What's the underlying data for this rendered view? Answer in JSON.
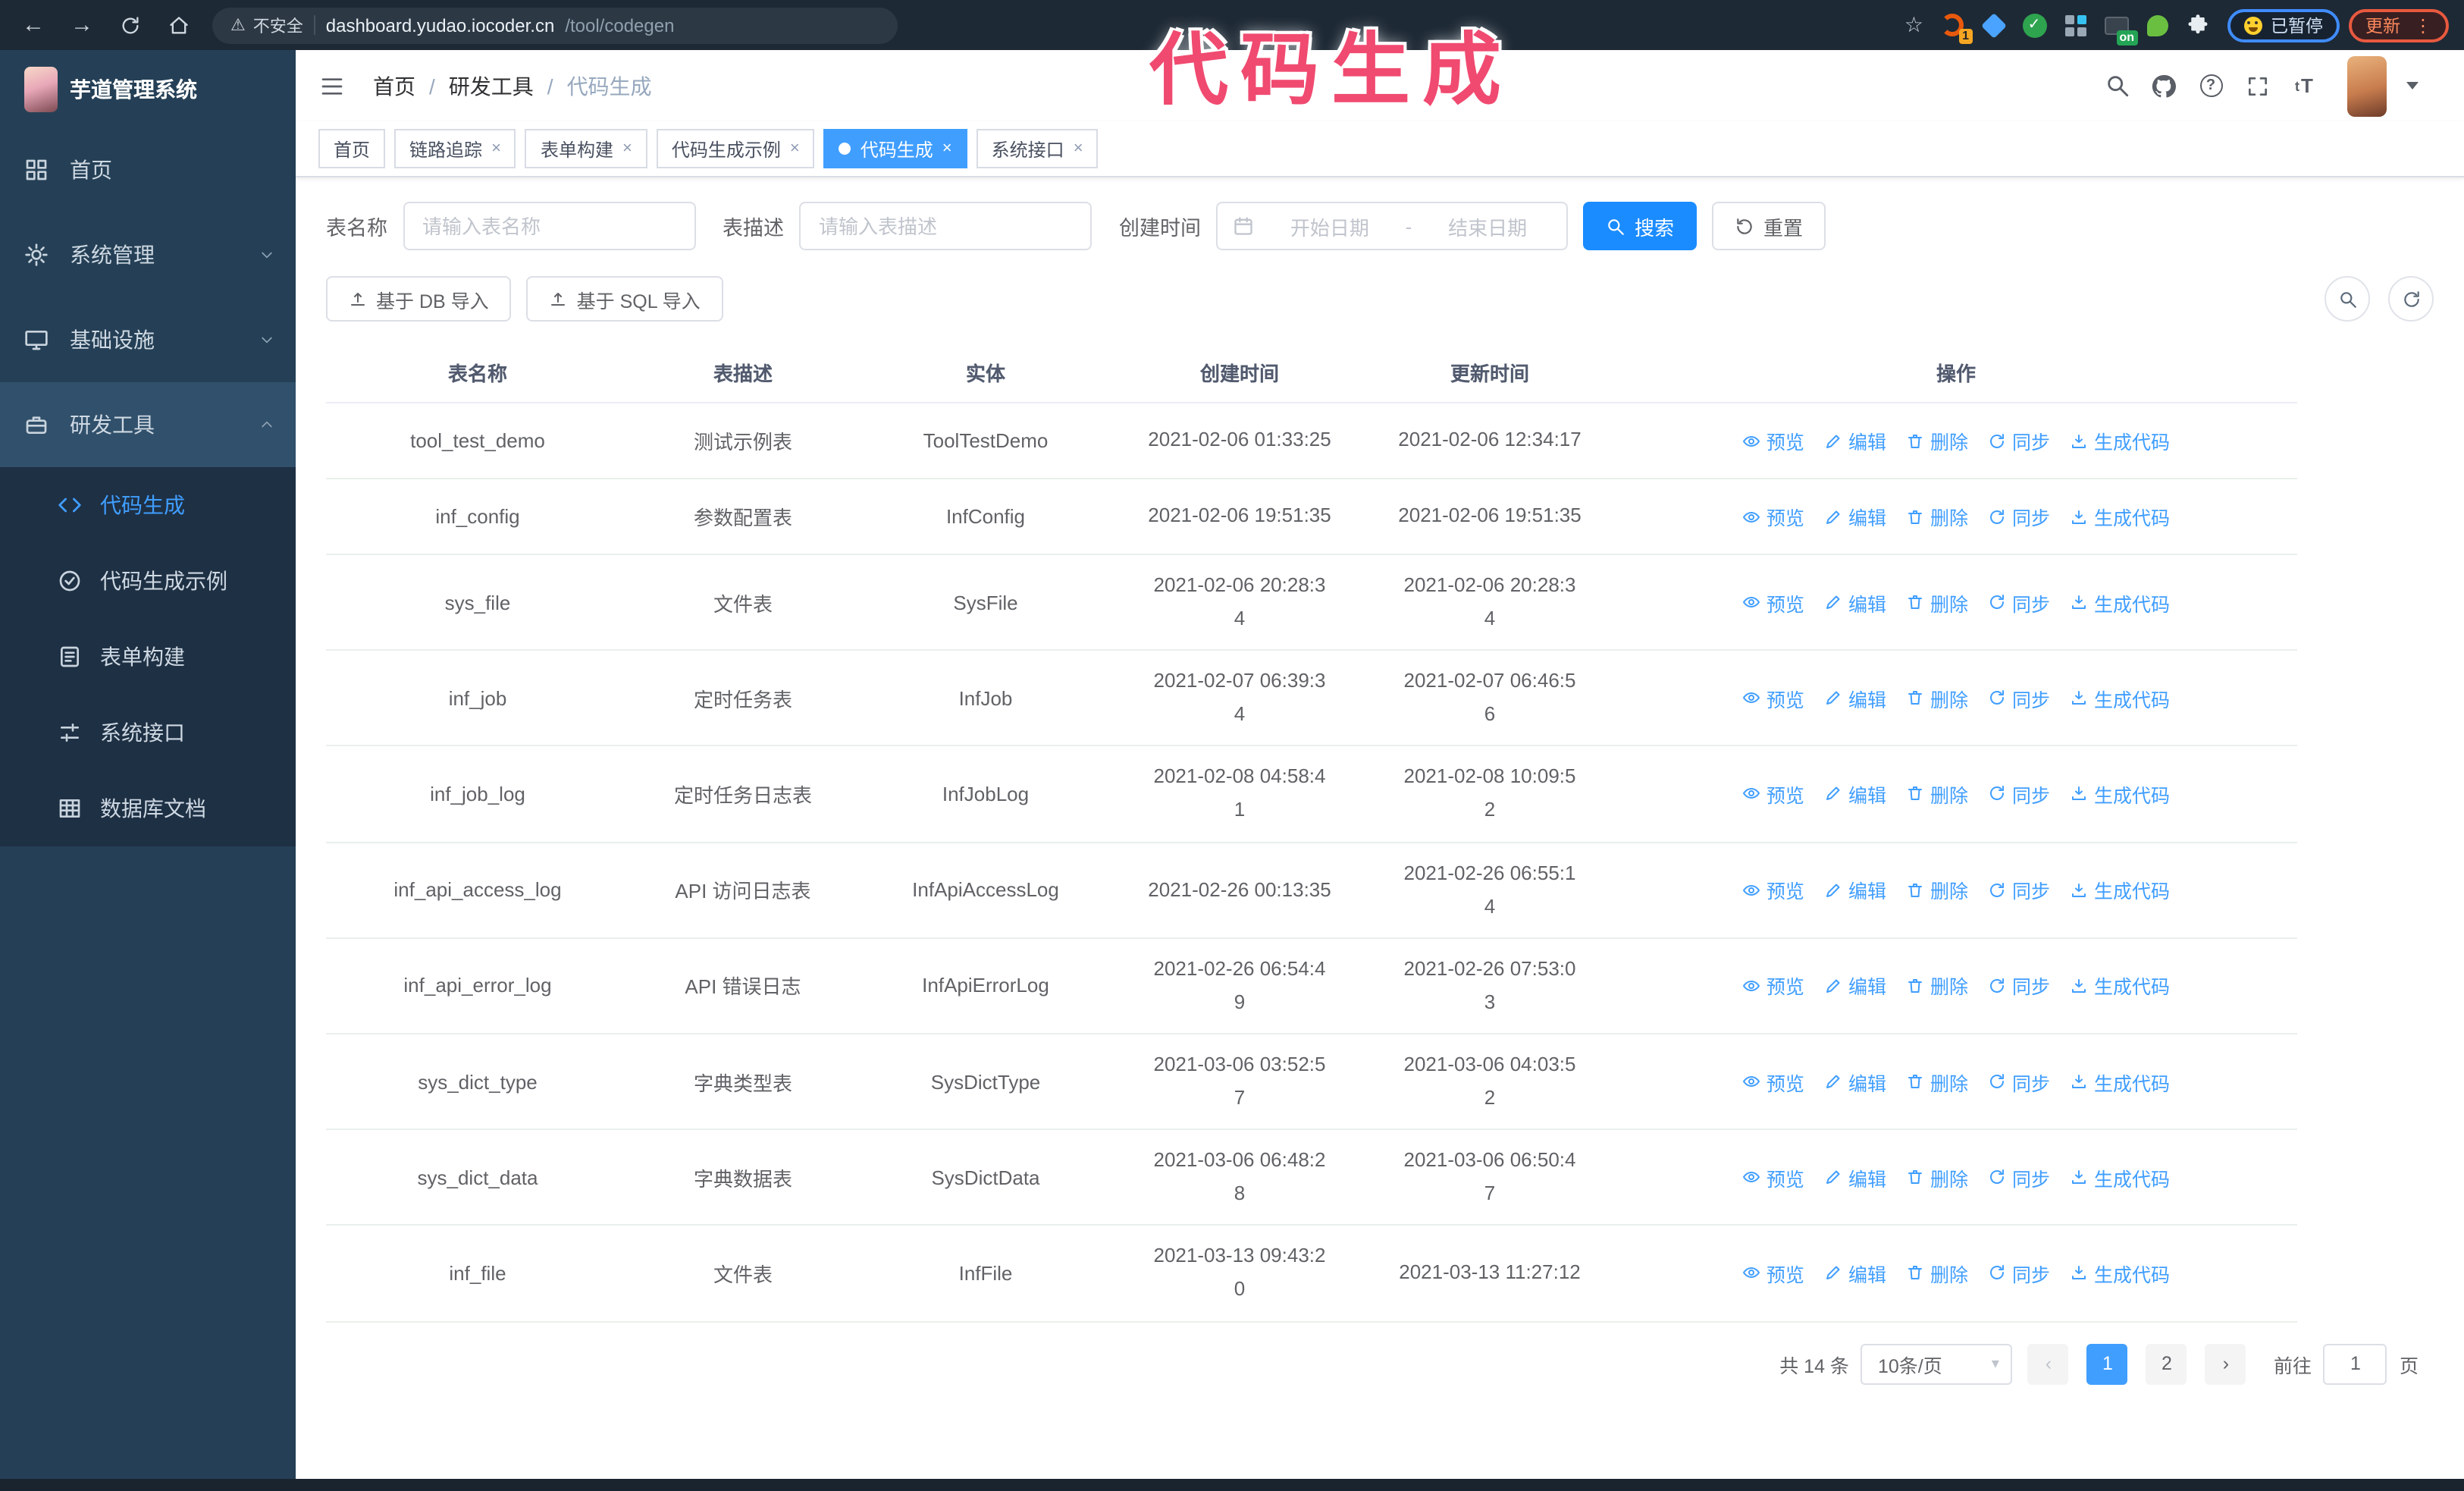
{
  "annotation": {
    "text": "代码生成",
    "color": "#f04a70"
  },
  "browser": {
    "warning_label": "不安全",
    "url_host": "dashboard.yudao.iocoder.cn",
    "url_path": "/tool/codegen",
    "extension_badge": "1",
    "extension_on_badge": "on",
    "paused_badge": "已暂停",
    "update_button": "更新"
  },
  "icons": {
    "star": "☆",
    "warning": "⚠",
    "caret_down": "▾",
    "kebab": "⋮",
    "check": "✓",
    "prev": "‹",
    "next": "›",
    "close": "×"
  },
  "sidebar": {
    "logo_title": "芋道管理系统",
    "items": [
      {
        "label": "首页",
        "icon": "dashboard-icon"
      },
      {
        "label": "系统管理",
        "icon": "gear-icon",
        "chevron": "down"
      },
      {
        "label": "基础设施",
        "icon": "infra-icon",
        "chevron": "down"
      },
      {
        "label": "研发工具",
        "icon": "tools-icon",
        "chevron": "up",
        "open": true
      }
    ],
    "submenu": [
      {
        "label": "代码生成",
        "icon": "code-icon",
        "active": true
      },
      {
        "label": "代码生成示例",
        "icon": "example-icon"
      },
      {
        "label": "表单构建",
        "icon": "form-icon"
      },
      {
        "label": "系统接口",
        "icon": "api-icon"
      },
      {
        "label": "数据库文档",
        "icon": "dbdoc-icon"
      }
    ]
  },
  "header": {
    "breadcrumb": [
      "首页",
      "研发工具",
      "代码生成"
    ],
    "separator": "/"
  },
  "tabs": [
    {
      "label": "首页",
      "closable": false,
      "active": false
    },
    {
      "label": "链路追踪",
      "closable": true,
      "active": false
    },
    {
      "label": "表单构建",
      "closable": true,
      "active": false
    },
    {
      "label": "代码生成示例",
      "closable": true,
      "active": false
    },
    {
      "label": "代码生成",
      "closable": true,
      "active": true
    },
    {
      "label": "系统接口",
      "closable": true,
      "active": false
    }
  ],
  "filters": {
    "name_label": "表名称",
    "name_placeholder": "请输入表名称",
    "desc_label": "表描述",
    "desc_placeholder": "请输入表描述",
    "time_label": "创建时间",
    "start_placeholder": "开始日期",
    "range_separator": "-",
    "end_placeholder": "结束日期",
    "search_label": "搜索",
    "reset_label": "重置"
  },
  "toolbar": {
    "db_import_label": "基于 DB 导入",
    "sql_import_label": "基于 SQL 导入"
  },
  "table": {
    "columns": [
      "表名称",
      "表描述",
      "实体",
      "创建时间",
      "更新时间",
      "操作"
    ],
    "actions": [
      "预览",
      "编辑",
      "删除",
      "同步",
      "生成代码"
    ],
    "rows": [
      {
        "name": "tool_test_demo",
        "desc": "测试示例表",
        "entity": "ToolTestDemo",
        "created": "2021-02-06 01:33:25",
        "updated": "2021-02-06 12:34:17"
      },
      {
        "name": "inf_config",
        "desc": "参数配置表",
        "entity": "InfConfig",
        "created": "2021-02-06 19:51:35",
        "updated": "2021-02-06 19:51:35"
      },
      {
        "name": "sys_file",
        "desc": "文件表",
        "entity": "SysFile",
        "created": "2021-02-06 20:28:3\n4",
        "updated": "2021-02-06 20:28:3\n4"
      },
      {
        "name": "inf_job",
        "desc": "定时任务表",
        "entity": "InfJob",
        "created": "2021-02-07 06:39:3\n4",
        "updated": "2021-02-07 06:46:5\n6"
      },
      {
        "name": "inf_job_log",
        "desc": "定时任务日志表",
        "entity": "InfJobLog",
        "created": "2021-02-08 04:58:4\n1",
        "updated": "2021-02-08 10:09:5\n2"
      },
      {
        "name": "inf_api_access_log",
        "desc": "API 访问日志表",
        "entity": "InfApiAccessLog",
        "created": "2021-02-26 00:13:35",
        "updated": "2021-02-26 06:55:1\n4"
      },
      {
        "name": "inf_api_error_log",
        "desc": "API 错误日志",
        "entity": "InfApiErrorLog",
        "created": "2021-02-26 06:54:4\n9",
        "updated": "2021-02-26 07:53:0\n3"
      },
      {
        "name": "sys_dict_type",
        "desc": "字典类型表",
        "entity": "SysDictType",
        "created": "2021-03-06 03:52:5\n7",
        "updated": "2021-03-06 04:03:5\n2"
      },
      {
        "name": "sys_dict_data",
        "desc": "字典数据表",
        "entity": "SysDictData",
        "created": "2021-03-06 06:48:2\n8",
        "updated": "2021-03-06 06:50:4\n7"
      },
      {
        "name": "inf_file",
        "desc": "文件表",
        "entity": "InfFile",
        "created": "2021-03-13 09:43:2\n0",
        "updated": "2021-03-13 11:27:12"
      }
    ]
  },
  "pagination": {
    "total": "共 14 条",
    "page_size": "10条/页",
    "pages": [
      "1",
      "2"
    ],
    "active_page": "1",
    "goto_label": "前往",
    "goto_value": "1",
    "goto_suffix": "页"
  }
}
